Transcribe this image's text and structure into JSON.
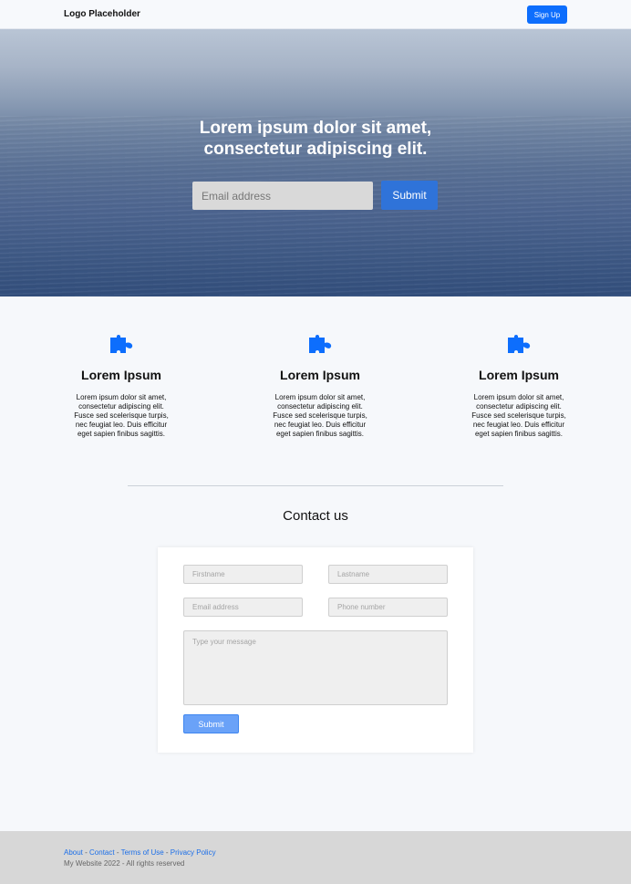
{
  "header": {
    "logo": "Logo Placeholder",
    "signup": "Sign Up"
  },
  "hero": {
    "line1": "Lorem ipsum dolor sit amet,",
    "line2": "consectetur adipiscing elit.",
    "email_placeholder": "Email address",
    "submit": "Submit"
  },
  "features": [
    {
      "icon": "puzzle-icon",
      "title": "Lorem Ipsum",
      "lines": [
        "Lorem ipsum dolor sit amet,",
        "consectetur adipiscing elit.",
        "Fusce sed scelerisque turpis,",
        "nec feugiat leo. Duis efficitur",
        "eget sapien finibus sagittis."
      ]
    },
    {
      "icon": "puzzle-icon",
      "title": "Lorem Ipsum",
      "lines": [
        "Lorem ipsum dolor sit amet,",
        "consectetur adipiscing elit.",
        "Fusce sed scelerisque turpis,",
        "nec feugiat leo. Duis efficitur",
        "eget sapien finibus sagittis."
      ]
    },
    {
      "icon": "puzzle-icon",
      "title": "Lorem Ipsum",
      "lines": [
        "Lorem ipsum dolor sit amet,",
        "consectetur adipiscing elit.",
        "Fusce sed scelerisque turpis,",
        "nec feugiat leo. Duis efficitur",
        "eget sapien finibus sagittis."
      ]
    }
  ],
  "contact": {
    "title": "Contact us",
    "firstname_placeholder": "Firstname",
    "lastname_placeholder": "Lastname",
    "email_placeholder": "Email address",
    "phone_placeholder": "Phone number",
    "message_placeholder": "Type your message",
    "submit": "Submit"
  },
  "footer": {
    "about": "About",
    "contact": "Contact",
    "terms": "Terms of Use",
    "privacy": "Privacy Policy",
    "separator": " - ",
    "copyright": "My Website 2022 - All rights reserved"
  },
  "colors": {
    "accent": "#0d6efd",
    "hero_button": "#2f73d9",
    "footer_background": "#d7d7d7"
  }
}
